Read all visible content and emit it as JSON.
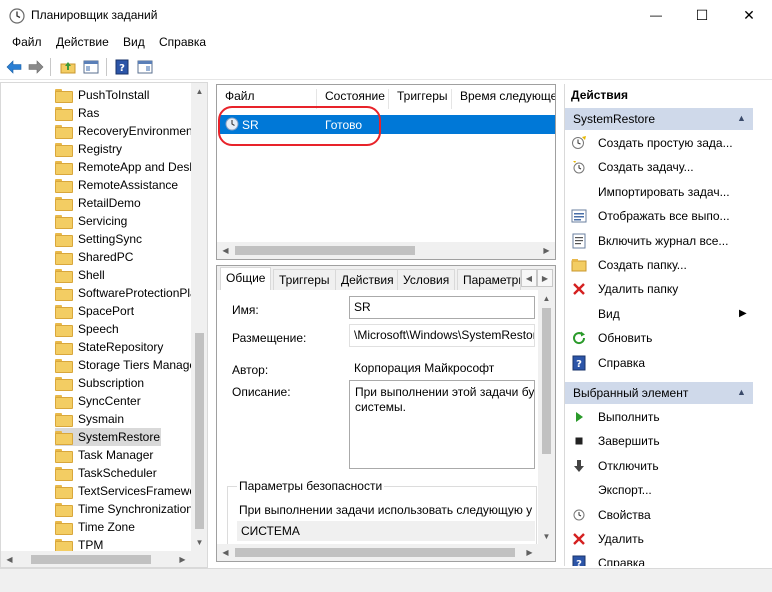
{
  "window": {
    "title": "Планировщик заданий",
    "min_glyph": "—",
    "max_glyph": "☐",
    "close_glyph": "✕"
  },
  "menu": [
    "Файл",
    "Действие",
    "Вид",
    "Справка"
  ],
  "tree": {
    "items": [
      "PushToInstall",
      "Ras",
      "RecoveryEnvironment",
      "Registry",
      "RemoteApp and Desktop",
      "RemoteAssistance",
      "RetailDemo",
      "Servicing",
      "SettingSync",
      "SharedPC",
      "Shell",
      "SoftwareProtectionPlatform",
      "SpacePort",
      "Speech",
      "StateRepository",
      "Storage Tiers Management",
      "Subscription",
      "SyncCenter",
      "Sysmain",
      "SystemRestore",
      "Task Manager",
      "TaskScheduler",
      "TextServicesFramework",
      "Time Synchronization",
      "Time Zone",
      "TPM"
    ],
    "selected": "SystemRestore"
  },
  "tasklist": {
    "columns": [
      "Файл",
      "Состояние",
      "Триггеры",
      "Время следующего"
    ],
    "rows": [
      {
        "name": "SR",
        "status": "Готово"
      }
    ]
  },
  "details": {
    "tabs": [
      "Общие",
      "Триггеры",
      "Действия",
      "Условия",
      "Параметры"
    ],
    "active_tab": "Общие",
    "name_label": "Имя:",
    "name_value": "SR",
    "location_label": "Размещение:",
    "location_value": "\\Microsoft\\Windows\\SystemRestore",
    "author_label": "Автор:",
    "author_value": "Корпорация Майкрософт",
    "description_label": "Описание:",
    "description_line1": "При выполнении этой задачи бу",
    "description_line2": "системы.",
    "security_legend": "Параметры безопасности",
    "security_text": "При выполнении задачи использовать следующую у",
    "account_value": "СИСТЕМА"
  },
  "actions": {
    "header": "Действия",
    "section1": {
      "title": "SystemRestore",
      "items": [
        {
          "label": "Создать простую зада...",
          "icon": "wizard-icon"
        },
        {
          "label": "Создать задачу...",
          "icon": "create-task-icon"
        },
        {
          "label": "Импортировать задач...",
          "icon": ""
        },
        {
          "label": "Отображать все выпо...",
          "icon": "running-tasks-icon"
        },
        {
          "label": "Включить журнал все...",
          "icon": "log-icon"
        },
        {
          "label": "Создать папку...",
          "icon": "new-folder-icon"
        },
        {
          "label": "Удалить папку",
          "icon": "delete-icon"
        },
        {
          "label": "Вид",
          "icon": ""
        },
        {
          "label": "Обновить",
          "icon": "refresh-icon"
        },
        {
          "label": "Справка",
          "icon": "help-icon"
        }
      ]
    },
    "section2": {
      "title": "Выбранный элемент",
      "items": [
        {
          "label": "Выполнить",
          "icon": "run-icon"
        },
        {
          "label": "Завершить",
          "icon": "stop-icon"
        },
        {
          "label": "Отключить",
          "icon": "disable-icon"
        },
        {
          "label": "Экспорт...",
          "icon": ""
        },
        {
          "label": "Свойства",
          "icon": "properties-icon"
        },
        {
          "label": "Удалить",
          "icon": "delete-icon"
        },
        {
          "label": "Справка",
          "icon": "help-icon"
        }
      ]
    }
  },
  "colors": {
    "selection": "#0078d7",
    "section_header": "#cfd9ea",
    "annotation": "#e8232a"
  }
}
